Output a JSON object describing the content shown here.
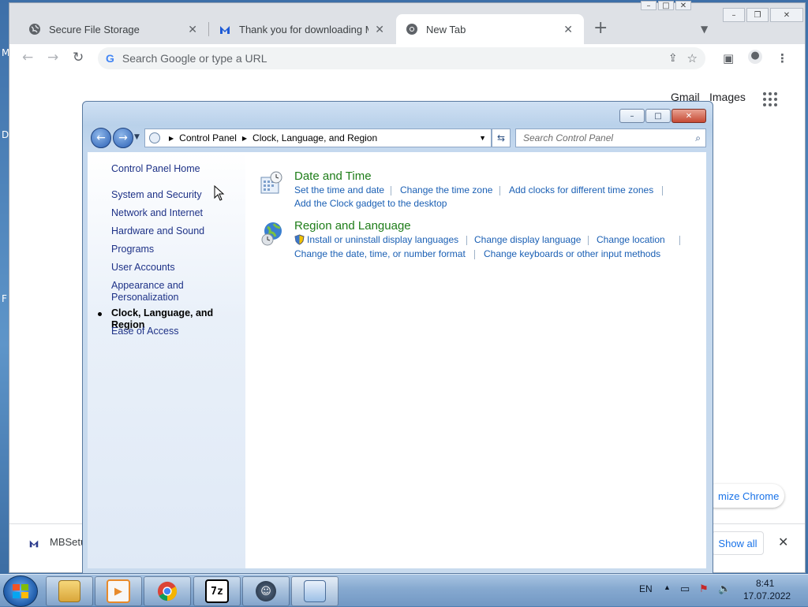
{
  "desktop": {
    "edge_letters": [
      "M",
      "D",
      "F"
    ]
  },
  "chrome": {
    "tabs": [
      {
        "title": "Secure File Storage",
        "icon": "globe-icon"
      },
      {
        "title": "Thank you for downloading Malw",
        "icon": "malwarebytes-icon"
      },
      {
        "title": "New Tab",
        "icon": "chrome-icon",
        "active": true
      }
    ],
    "omnibox_placeholder": "Search Google or type a URL",
    "ntp": {
      "gmail": "Gmail",
      "images": "Images",
      "customize": "mize Chrome"
    },
    "download_bar": {
      "file_name": "MBSetu",
      "show_all": "Show all"
    }
  },
  "control_panel": {
    "breadcrumb": [
      "Control Panel",
      "Clock, Language, and Region"
    ],
    "search_placeholder": "Search Control Panel",
    "nav": {
      "home": "Control Panel Home",
      "items": [
        "System and Security",
        "Network and Internet",
        "Hardware and Sound",
        "Programs",
        "User Accounts",
        "Appearance and",
        "Personalization",
        "Clock, Language, and Region",
        "Ease of Access"
      ],
      "active_index": 7
    },
    "categories": [
      {
        "title": "Date and Time",
        "links": [
          "Set the time and date",
          "Change the time zone",
          "Add clocks for different time zones",
          "Add the Clock gadget to the desktop"
        ]
      },
      {
        "title": "Region and Language",
        "links": [
          "Install or uninstall display languages",
          "Change display language",
          "Change location",
          "Change the date, time, or number format",
          "Change keyboards or other input methods"
        ]
      }
    ]
  },
  "taskbar": {
    "apps": [
      "explorer-icon",
      "media-player-icon",
      "chrome-icon",
      "7zip-icon",
      "assistant-icon",
      "control-panel-icon"
    ],
    "language": "EN",
    "time": "8:41",
    "date": "17.07.2022"
  },
  "colors": {
    "link": "#1a5fb4",
    "category_title": "#1e7d19",
    "chrome_link": "#1a73e8"
  }
}
